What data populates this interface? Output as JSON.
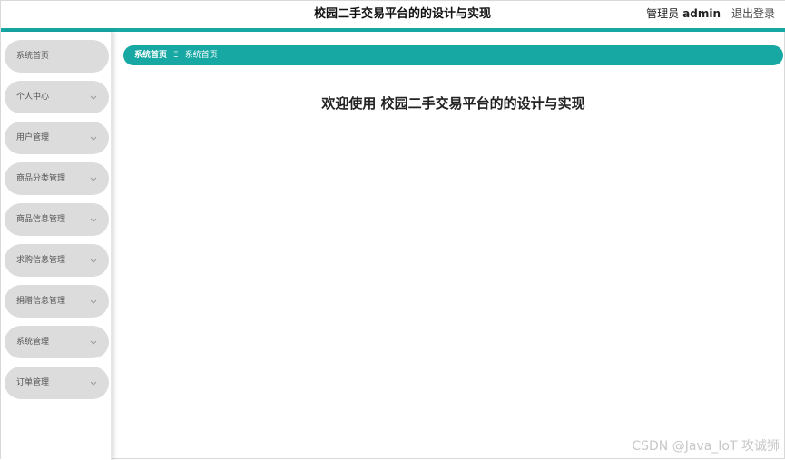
{
  "header": {
    "title": "校园二手交易平台的的设计与实现",
    "user_role": "管理员",
    "user_name": "admin",
    "logout_label": "退出登录",
    "accent_color": "#17a8a4"
  },
  "sidebar": {
    "items": [
      {
        "label": "系统首页",
        "has_submenu": false
      },
      {
        "label": "个人中心",
        "has_submenu": true
      },
      {
        "label": "用户管理",
        "has_submenu": true
      },
      {
        "label": "商品分类管理",
        "has_submenu": true
      },
      {
        "label": "商品信息管理",
        "has_submenu": true
      },
      {
        "label": "求购信息管理",
        "has_submenu": true
      },
      {
        "label": "捐赠信息管理",
        "has_submenu": true
      },
      {
        "label": "系统管理",
        "has_submenu": true
      },
      {
        "label": "订单管理",
        "has_submenu": true
      }
    ],
    "chevron_icon": "chevron-down-icon"
  },
  "breadcrumb": {
    "items": [
      "系统首页",
      "系统首页"
    ],
    "separator": "Ξ"
  },
  "main": {
    "welcome": "欢迎使用 校园二手交易平台的的设计与实现"
  },
  "watermark": "CSDN @Java_IoT 攻诚狮"
}
